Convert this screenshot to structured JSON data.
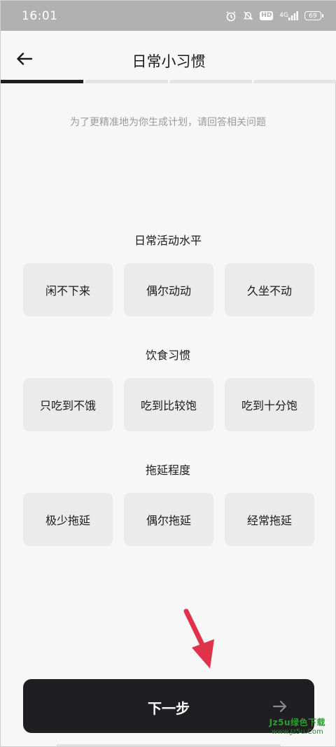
{
  "status_bar": {
    "time": "16:01",
    "hd_badge": "HD",
    "network": "4G",
    "battery": "69"
  },
  "header": {
    "title": "日常小习惯",
    "progress": {
      "total_steps": 4,
      "current_step": 1
    }
  },
  "subtitle": "为了更精准地为你生成计划，请回答相关问题",
  "sections": [
    {
      "title": "日常活动水平",
      "options": [
        "闲不下来",
        "偶尔动动",
        "久坐不动"
      ]
    },
    {
      "title": "饮食习惯",
      "options": [
        "只吃到不饿",
        "吃到比较饱",
        "吃到十分饱"
      ]
    },
    {
      "title": "拖延程度",
      "options": [
        "极少拖延",
        "偶尔拖延",
        "经常拖延"
      ]
    }
  ],
  "next_button": {
    "label": "下一步"
  },
  "watermark": {
    "line1": "Jz5u绿色下载",
    "line2": "www.Jz5u.Com"
  },
  "colors": {
    "accent_dark": "#1f1f22",
    "pointer_arrow": "#e0324a",
    "status_bar_bg": "#b1b1b1",
    "option_bg": "#ebebeb",
    "watermark_green": "#2f9a33"
  }
}
